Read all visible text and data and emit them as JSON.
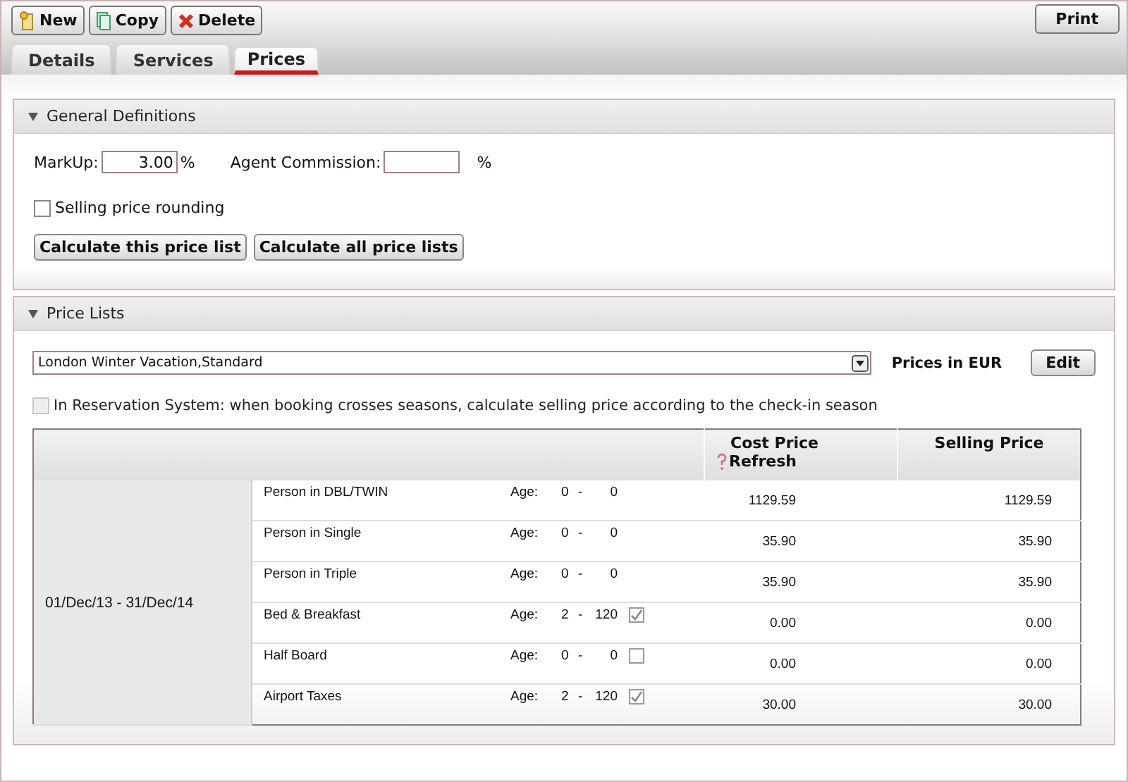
{
  "toolbar": {
    "buttons": [
      {
        "label": "New",
        "kind": "new"
      },
      {
        "label": "Copy",
        "kind": "copy"
      },
      {
        "label": "Delete",
        "kind": "delete"
      }
    ],
    "print": "Print"
  },
  "tabs": [
    {
      "label": "Details",
      "selected": false
    },
    {
      "label": "Services",
      "selected": false
    },
    {
      "label": "Prices",
      "selected": true
    }
  ],
  "general": {
    "title": "General Definitions",
    "expanded": true,
    "markup_label": "MarkUp:",
    "markup_value": "3.00",
    "markup_unit": "%",
    "commission_label": "Agent Commission:",
    "commission_unit": "%",
    "rounding": {
      "label": "Selling price rounding",
      "checked": false
    },
    "buttons": [
      "Calculate this price list",
      "Calculate all price lists"
    ]
  },
  "price_lists": {
    "title": "Price Lists",
    "expanded": true,
    "selected_list": "London Winter Vacation,Standard",
    "currency": "Prices in EUR",
    "edit": "Edit",
    "crossing": {
      "label": "In Reservation System: when booking crosses seasons, calculate selling price according to the check-in season",
      "checked": false,
      "disabled": true
    },
    "table": {
      "columns": {
        "cost": "Cost Price",
        "refresh": "Refresh",
        "selling": "Selling Price"
      },
      "period": "01/Dec/13 - 31/Dec/14",
      "rows": [
        {
          "name": "Person in DBL/TWIN",
          "age_label": "Age:",
          "age_from": "0",
          "dash": "-",
          "age_to": "0",
          "cost": "1129.59",
          "selling": "1129.59"
        },
        {
          "name": "Person in Single",
          "age_label": "Age:",
          "age_from": "0",
          "dash": "-",
          "age_to": "0",
          "cost": "35.90",
          "selling": "35.90"
        },
        {
          "name": "Person in Triple",
          "age_label": "Age:",
          "age_from": "0",
          "dash": "-",
          "age_to": "0",
          "cost": "35.90",
          "selling": "35.90"
        },
        {
          "name": "Bed & Breakfast",
          "age_label": "Age:",
          "age_from": "2",
          "dash": "-",
          "age_to": "120",
          "checked": true,
          "cost": "0.00",
          "selling": "0.00"
        },
        {
          "name": "Half Board",
          "age_label": "Age:",
          "age_from": "0",
          "dash": "-",
          "age_to": "0",
          "checked": false,
          "cost": "0.00",
          "selling": "0.00"
        },
        {
          "name": "Airport Taxes",
          "age_label": "Age:",
          "age_from": "2",
          "dash": "-",
          "age_to": "120",
          "checked": true,
          "cost": "30.00",
          "selling": "30.00"
        }
      ]
    }
  }
}
